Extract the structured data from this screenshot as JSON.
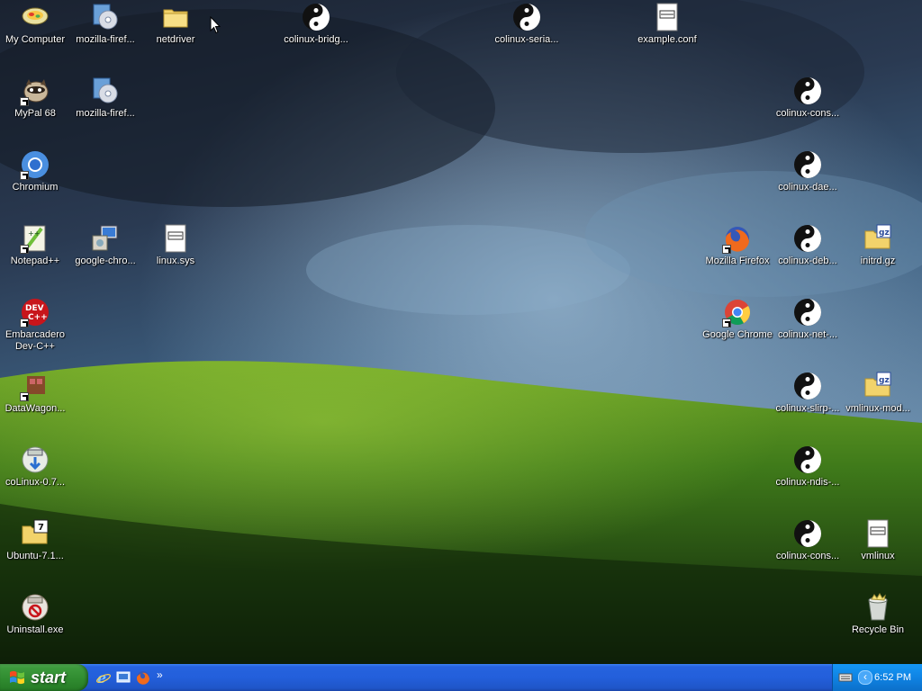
{
  "desktop": {
    "icons": [
      {
        "id": "my-computer",
        "label": "My Computer"
      },
      {
        "id": "mozilla-firefox-setup-1",
        "label": "mozilla-firef..."
      },
      {
        "id": "netdriver",
        "label": "netdriver"
      },
      {
        "id": "colinux-bridged",
        "label": "colinux-bridg..."
      },
      {
        "id": "colinux-serial",
        "label": "colinux-seria..."
      },
      {
        "id": "example-conf",
        "label": "example.conf"
      },
      {
        "id": "mypal-68",
        "label": "MyPal 68"
      },
      {
        "id": "mozilla-firefox-setup-2",
        "label": "mozilla-firef..."
      },
      {
        "id": "colinux-console-1",
        "label": "colinux-cons..."
      },
      {
        "id": "chromium",
        "label": "Chromium"
      },
      {
        "id": "colinux-daemon",
        "label": "colinux-dae..."
      },
      {
        "id": "notepad-plus-plus",
        "label": "Notepad++"
      },
      {
        "id": "google-chrome-installer",
        "label": "google-chro..."
      },
      {
        "id": "linux-sys",
        "label": "linux.sys"
      },
      {
        "id": "mozilla-firefox",
        "label": "Mozilla Firefox"
      },
      {
        "id": "colinux-debug",
        "label": "colinux-deb..."
      },
      {
        "id": "initrd-gz",
        "label": "initrd.gz"
      },
      {
        "id": "embarcadero-devcpp",
        "label": "Embarcadero\nDev-C++"
      },
      {
        "id": "google-chrome",
        "label": "Google Chrome"
      },
      {
        "id": "colinux-net",
        "label": "colinux-net-..."
      },
      {
        "id": "datawagon",
        "label": "DataWagon..."
      },
      {
        "id": "colinux-slirp",
        "label": "colinux-slirp-..."
      },
      {
        "id": "vmlinux-modules",
        "label": "vmlinux-mod..."
      },
      {
        "id": "colinux-installer",
        "label": "coLinux-0.7..."
      },
      {
        "id": "colinux-ndis",
        "label": "colinux-ndis-..."
      },
      {
        "id": "ubuntu-archive",
        "label": "Ubuntu-7.1..."
      },
      {
        "id": "colinux-console-2",
        "label": "colinux-cons..."
      },
      {
        "id": "vmlinux",
        "label": "vmlinux"
      },
      {
        "id": "uninstall-exe",
        "label": "Uninstall.exe"
      },
      {
        "id": "recycle-bin",
        "label": "Recycle Bin"
      }
    ]
  },
  "taskbar": {
    "start_label": "start",
    "quick_launch_more": "»",
    "tray_more": "‹",
    "clock": "6:52 PM"
  },
  "icons": {
    "my-computer": "computer-icon",
    "mozilla-firefox-setup-1": "installer-cd-icon",
    "netdriver": "folder-icon",
    "colinux-bridged": "yin-yang-penguin-icon",
    "colinux-serial": "yin-yang-penguin-icon",
    "example-conf": "text-file-icon",
    "mypal-68": "raccoon-icon",
    "mozilla-firefox-setup-2": "installer-cd-icon",
    "colinux-console-1": "yin-yang-penguin-icon",
    "chromium": "chromium-icon",
    "colinux-daemon": "yin-yang-penguin-icon",
    "notepad-plus-plus": "notepad-icon",
    "google-chrome-installer": "installer-computer-icon",
    "linux-sys": "system-file-icon",
    "mozilla-firefox": "firefox-icon",
    "colinux-debug": "yin-yang-penguin-icon",
    "initrd-gz": "gz-archive-icon",
    "embarcadero-devcpp": "devcpp-icon",
    "google-chrome": "chrome-icon",
    "colinux-net": "yin-yang-penguin-icon",
    "datawagon": "datawagon-icon",
    "colinux-slirp": "yin-yang-penguin-icon",
    "vmlinux-modules": "gz-archive-icon",
    "colinux-installer": "installer-download-icon",
    "colinux-ndis": "yin-yang-penguin-icon",
    "ubuntu-archive": "7z-archive-icon",
    "colinux-console-2": "yin-yang-penguin-icon",
    "vmlinux": "system-file-icon",
    "uninstall-exe": "uninstall-icon",
    "recycle-bin": "recycle-bin-icon"
  },
  "colors": {
    "taskbar_blue": "#235fdb",
    "start_green": "#3c9a3c",
    "tray_blue": "#0f83e3"
  }
}
